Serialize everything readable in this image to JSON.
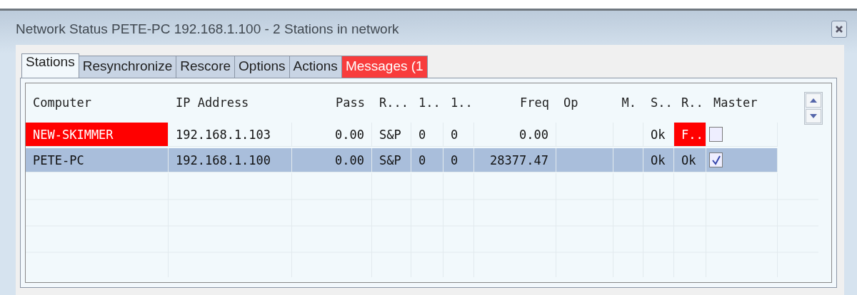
{
  "window": {
    "title": "Network Status PETE-PC 192.168.1.100 - 2 Stations in network"
  },
  "tabs": [
    {
      "label": "Stations",
      "selected": true,
      "alert": false
    },
    {
      "label": "Resynchronize",
      "selected": false,
      "alert": false
    },
    {
      "label": "Rescore",
      "selected": false,
      "alert": false
    },
    {
      "label": "Options",
      "selected": false,
      "alert": false
    },
    {
      "label": "Actions",
      "selected": false,
      "alert": false
    },
    {
      "label": "Messages (1",
      "selected": false,
      "alert": true
    }
  ],
  "table": {
    "columns": [
      "Computer",
      "IP Address",
      "Pass",
      "R...",
      "1..",
      "1..",
      "Freq",
      "Op",
      "M.",
      "S..",
      "R..",
      "Master"
    ],
    "rows": [
      {
        "selected": false,
        "master_checked": false,
        "cells": [
          {
            "text": "NEW-SKIMMER",
            "alert": true
          },
          {
            "text": "192.168.1.103",
            "alert": false
          },
          {
            "text": "0.00",
            "alert": false
          },
          {
            "text": "S&P",
            "alert": false
          },
          {
            "text": "0",
            "alert": false
          },
          {
            "text": "0",
            "alert": false
          },
          {
            "text": "0.00",
            "alert": false
          },
          {
            "text": "",
            "alert": false
          },
          {
            "text": "",
            "alert": false
          },
          {
            "text": "Ok",
            "alert": false
          },
          {
            "text": "F..",
            "alert": true
          }
        ]
      },
      {
        "selected": true,
        "master_checked": true,
        "cells": [
          {
            "text": "PETE-PC",
            "alert": false
          },
          {
            "text": "192.168.1.100",
            "alert": false
          },
          {
            "text": "0.00",
            "alert": false
          },
          {
            "text": "S&P",
            "alert": false
          },
          {
            "text": "0",
            "alert": false
          },
          {
            "text": "0",
            "alert": false
          },
          {
            "text": "28377.47",
            "alert": false
          },
          {
            "text": "",
            "alert": false
          },
          {
            "text": "",
            "alert": false
          },
          {
            "text": "Ok",
            "alert": false
          },
          {
            "text": "Ok",
            "alert": false
          }
        ]
      }
    ]
  }
}
